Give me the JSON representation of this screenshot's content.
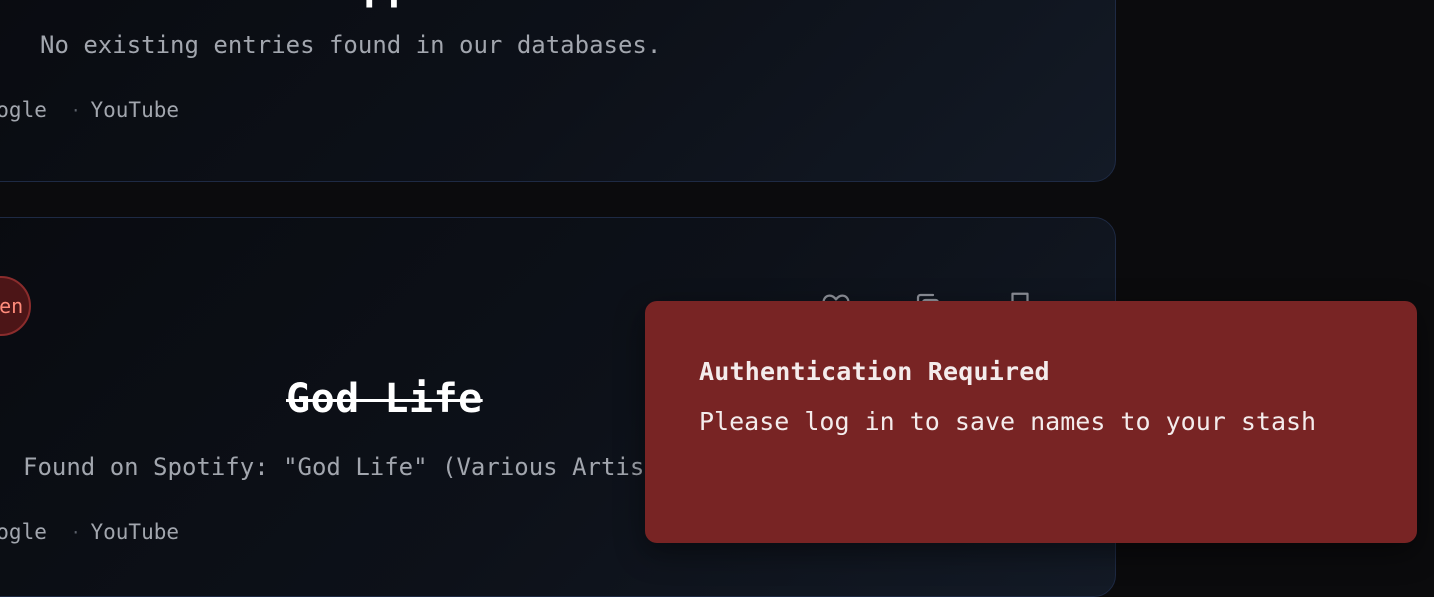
{
  "cards": [
    {
      "title": "Luck Apparent",
      "description": "No existing entries found in our databases.",
      "links": [
        "Google",
        "YouTube"
      ]
    },
    {
      "title": "God Life",
      "description": "Found on Spotify: \"God Life\" (Various Artists)",
      "links": [
        "Google",
        "YouTube"
      ],
      "status_badge": "Taken",
      "status_color": "#ff8b7b",
      "actions": [
        "heart-icon",
        "copy-icon",
        "bookmark-icon"
      ]
    }
  ],
  "toast": {
    "title": "Authentication Required",
    "message": "Please log in to save names to your stash",
    "background": "#782424"
  }
}
